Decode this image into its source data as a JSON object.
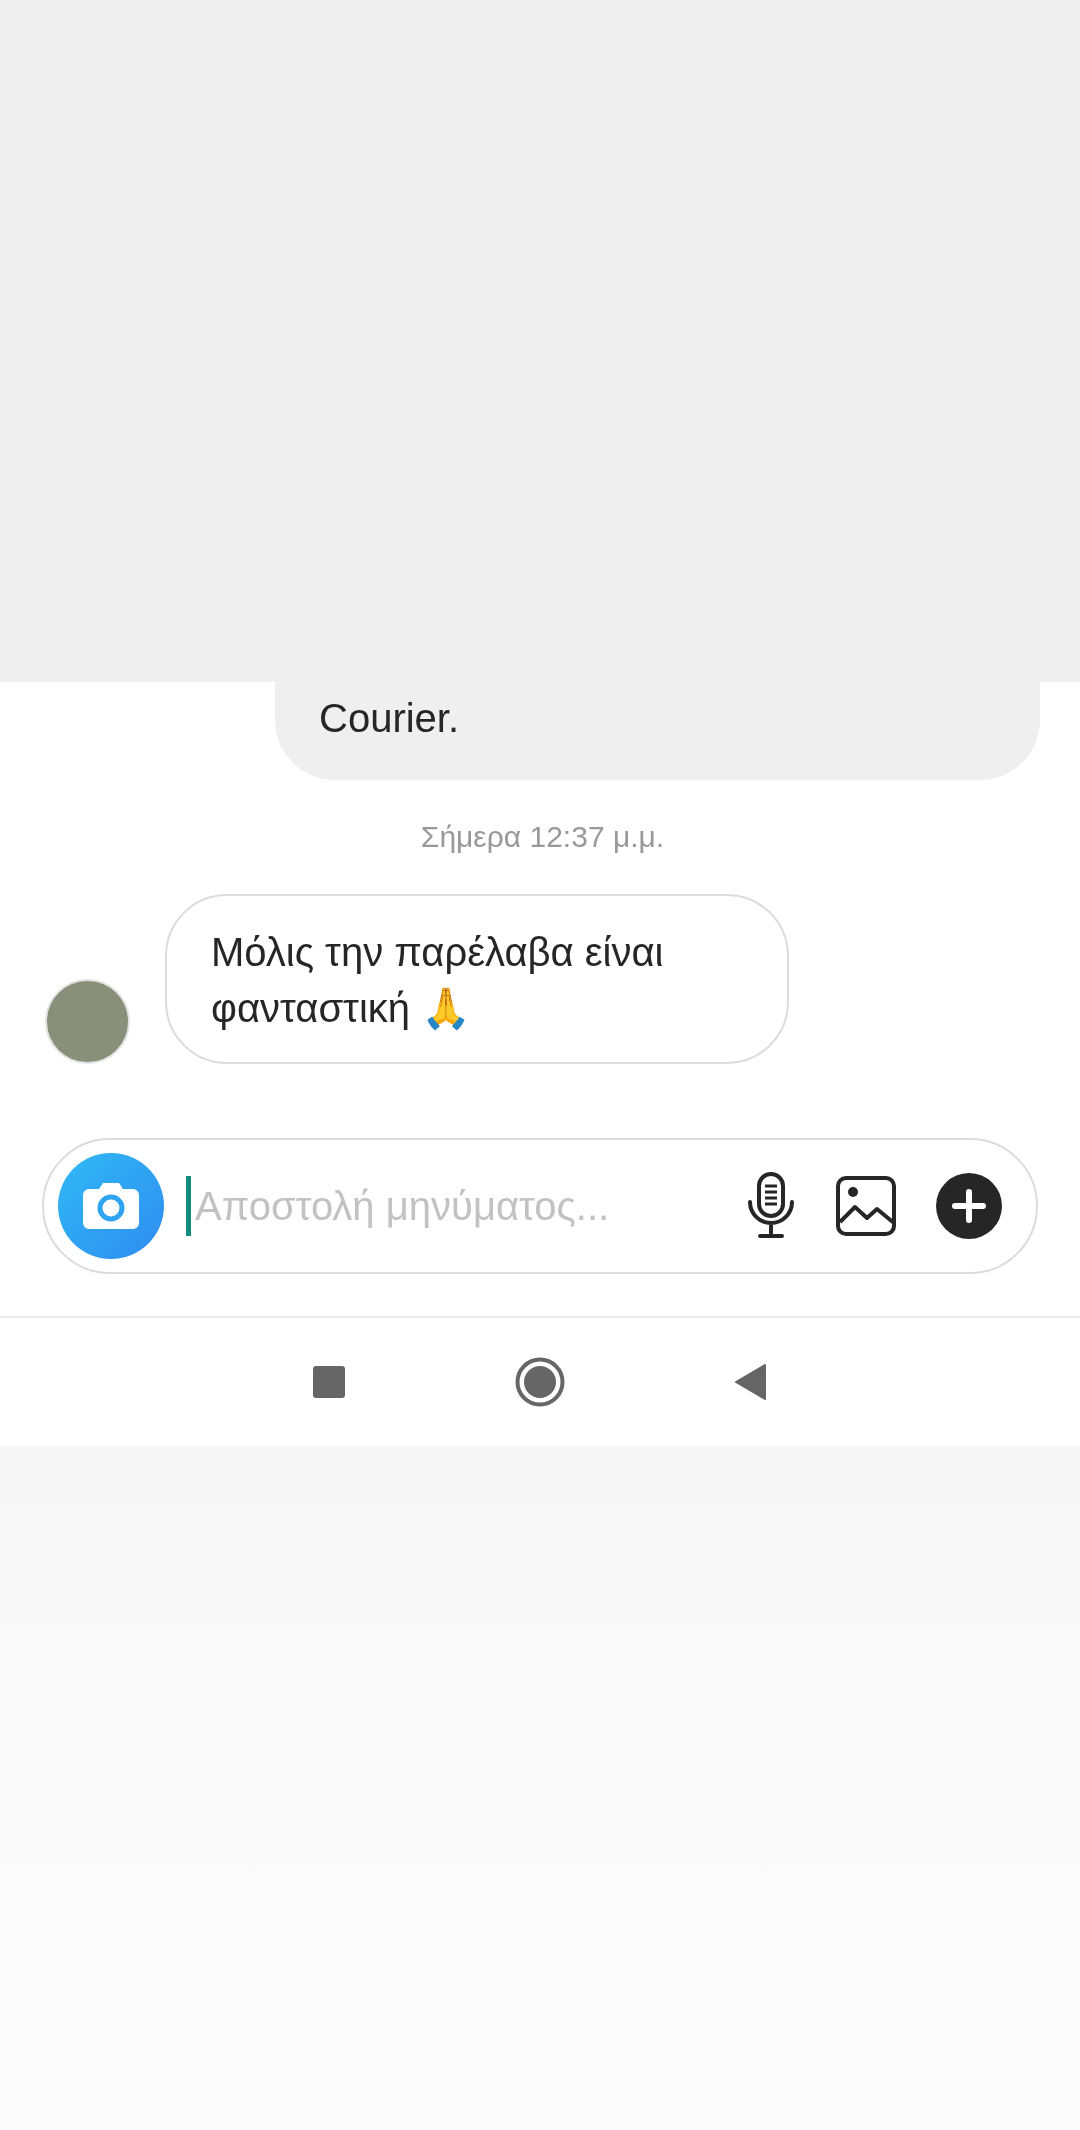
{
  "messages": [
    {
      "kind": "outgoing",
      "text": "Courier."
    },
    {
      "kind": "timestamp",
      "text": "Σήμερα 12:37 μ.μ."
    },
    {
      "kind": "incoming",
      "text": "Μόλις την παρέλαβα είναι φανταστική 🙏"
    }
  ],
  "composer": {
    "placeholder": "Αποστολή μηνύματος..."
  }
}
